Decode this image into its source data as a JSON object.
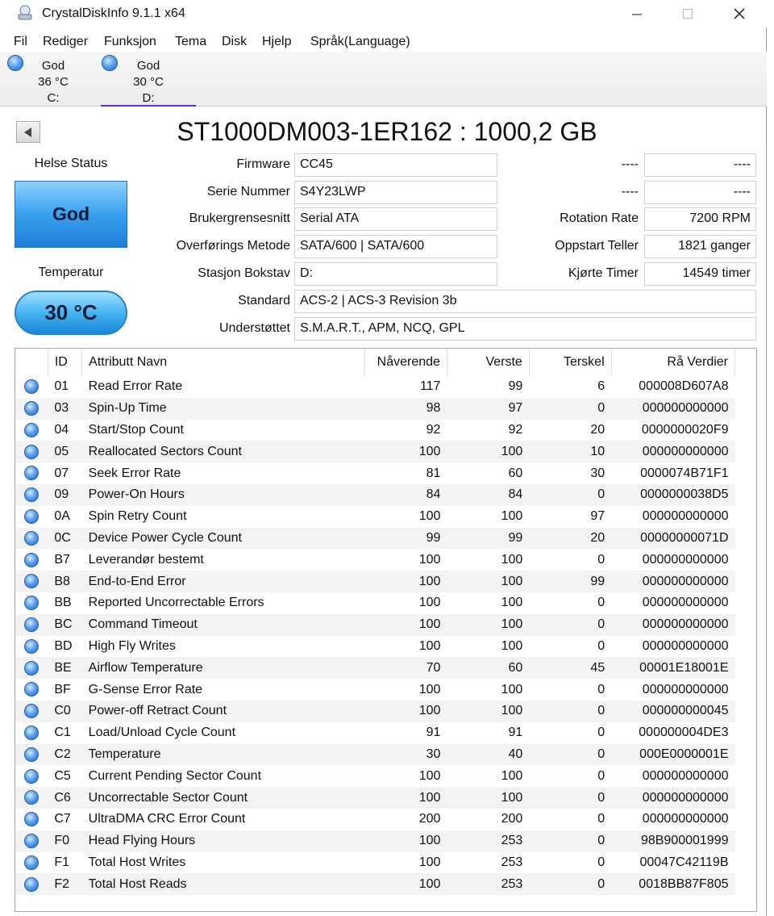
{
  "window": {
    "title": "CrystalDiskInfo 9.1.1 x64"
  },
  "menu": [
    "Fil",
    "Rediger",
    "Funksjon",
    "Tema",
    "Disk",
    "Hjelp",
    "Språk(Language)"
  ],
  "drives": [
    {
      "status": "God",
      "temp": "36 °C",
      "letter": "C:"
    },
    {
      "status": "God",
      "temp": "30 °C",
      "letter": "D:"
    }
  ],
  "disk": {
    "title": "ST1000DM003-1ER162 : 1000,2 GB",
    "health_label": "Helse Status",
    "health_value": "God",
    "temperature_label": "Temperatur",
    "temperature_value": "30 °C",
    "firmware_label": "Firmware",
    "firmware": "CC45",
    "serial_label": "Serie Nummer",
    "serial": "S4Y23LWP",
    "interface_label": "Brukergrensesnitt",
    "interface": "Serial ATA",
    "transfer_label": "Overførings Metode",
    "transfer": "SATA/600 | SATA/600",
    "letter_label": "Stasjon Bokstav",
    "letter": "D:",
    "standard_label": "Standard",
    "standard": "ACS-2 | ACS-3 Revision 3b",
    "features_label": "Understøttet",
    "features": "S.M.A.R.T., APM, NCQ, GPL",
    "blank1_label": "----",
    "blank1_value": "----",
    "blank2_label": "----",
    "blank2_value": "----",
    "rotation_label": "Rotation Rate",
    "rotation": "7200 RPM",
    "powercount_label": "Oppstart Teller",
    "powercount": "1821 ganger",
    "hours_label": "Kjørte Timer",
    "hours": "14549 timer"
  },
  "smart": {
    "headers": {
      "id": "ID",
      "name": "Attributt Navn",
      "current": "Nåverende",
      "worst": "Verste",
      "threshold": "Terskel",
      "raw": "Rå Verdier"
    },
    "rows": [
      {
        "id": "01",
        "name": "Read Error Rate",
        "current": "117",
        "worst": "99",
        "threshold": "6",
        "raw": "000008D607A8"
      },
      {
        "id": "03",
        "name": "Spin-Up Time",
        "current": "98",
        "worst": "97",
        "threshold": "0",
        "raw": "000000000000"
      },
      {
        "id": "04",
        "name": "Start/Stop Count",
        "current": "92",
        "worst": "92",
        "threshold": "20",
        "raw": "0000000020F9"
      },
      {
        "id": "05",
        "name": "Reallocated Sectors Count",
        "current": "100",
        "worst": "100",
        "threshold": "10",
        "raw": "000000000000"
      },
      {
        "id": "07",
        "name": "Seek Error Rate",
        "current": "81",
        "worst": "60",
        "threshold": "30",
        "raw": "0000074B71F1"
      },
      {
        "id": "09",
        "name": "Power-On Hours",
        "current": "84",
        "worst": "84",
        "threshold": "0",
        "raw": "0000000038D5"
      },
      {
        "id": "0A",
        "name": "Spin Retry Count",
        "current": "100",
        "worst": "100",
        "threshold": "97",
        "raw": "000000000000"
      },
      {
        "id": "0C",
        "name": "Device Power Cycle Count",
        "current": "99",
        "worst": "99",
        "threshold": "20",
        "raw": "00000000071D"
      },
      {
        "id": "B7",
        "name": "Leverandør bestemt",
        "current": "100",
        "worst": "100",
        "threshold": "0",
        "raw": "000000000000"
      },
      {
        "id": "B8",
        "name": "End-to-End Error",
        "current": "100",
        "worst": "100",
        "threshold": "99",
        "raw": "000000000000"
      },
      {
        "id": "BB",
        "name": "Reported Uncorrectable Errors",
        "current": "100",
        "worst": "100",
        "threshold": "0",
        "raw": "000000000000"
      },
      {
        "id": "BC",
        "name": "Command Timeout",
        "current": "100",
        "worst": "100",
        "threshold": "0",
        "raw": "000000000000"
      },
      {
        "id": "BD",
        "name": "High Fly Writes",
        "current": "100",
        "worst": "100",
        "threshold": "0",
        "raw": "000000000000"
      },
      {
        "id": "BE",
        "name": "Airflow Temperature",
        "current": "70",
        "worst": "60",
        "threshold": "45",
        "raw": "00001E18001E"
      },
      {
        "id": "BF",
        "name": "G-Sense Error Rate",
        "current": "100",
        "worst": "100",
        "threshold": "0",
        "raw": "000000000000"
      },
      {
        "id": "C0",
        "name": "Power-off Retract Count",
        "current": "100",
        "worst": "100",
        "threshold": "0",
        "raw": "000000000045"
      },
      {
        "id": "C1",
        "name": "Load/Unload Cycle Count",
        "current": "91",
        "worst": "91",
        "threshold": "0",
        "raw": "000000004DE3"
      },
      {
        "id": "C2",
        "name": "Temperature",
        "current": "30",
        "worst": "40",
        "threshold": "0",
        "raw": "000E0000001E"
      },
      {
        "id": "C5",
        "name": "Current Pending Sector Count",
        "current": "100",
        "worst": "100",
        "threshold": "0",
        "raw": "000000000000"
      },
      {
        "id": "C6",
        "name": "Uncorrectable Sector Count",
        "current": "100",
        "worst": "100",
        "threshold": "0",
        "raw": "000000000000"
      },
      {
        "id": "C7",
        "name": "UltraDMA CRC Error Count",
        "current": "200",
        "worst": "200",
        "threshold": "0",
        "raw": "000000000000"
      },
      {
        "id": "F0",
        "name": "Head Flying Hours",
        "current": "100",
        "worst": "253",
        "threshold": "0",
        "raw": "98B900001999"
      },
      {
        "id": "F1",
        "name": "Total Host Writes",
        "current": "100",
        "worst": "253",
        "threshold": "0",
        "raw": "00047C42119B"
      },
      {
        "id": "F2",
        "name": "Total Host Reads",
        "current": "100",
        "worst": "253",
        "threshold": "0",
        "raw": "0018BB87F805"
      }
    ]
  },
  "colors": {
    "health_good": "#3aa2f0",
    "active_tab_underline": "#6a2dd6"
  }
}
